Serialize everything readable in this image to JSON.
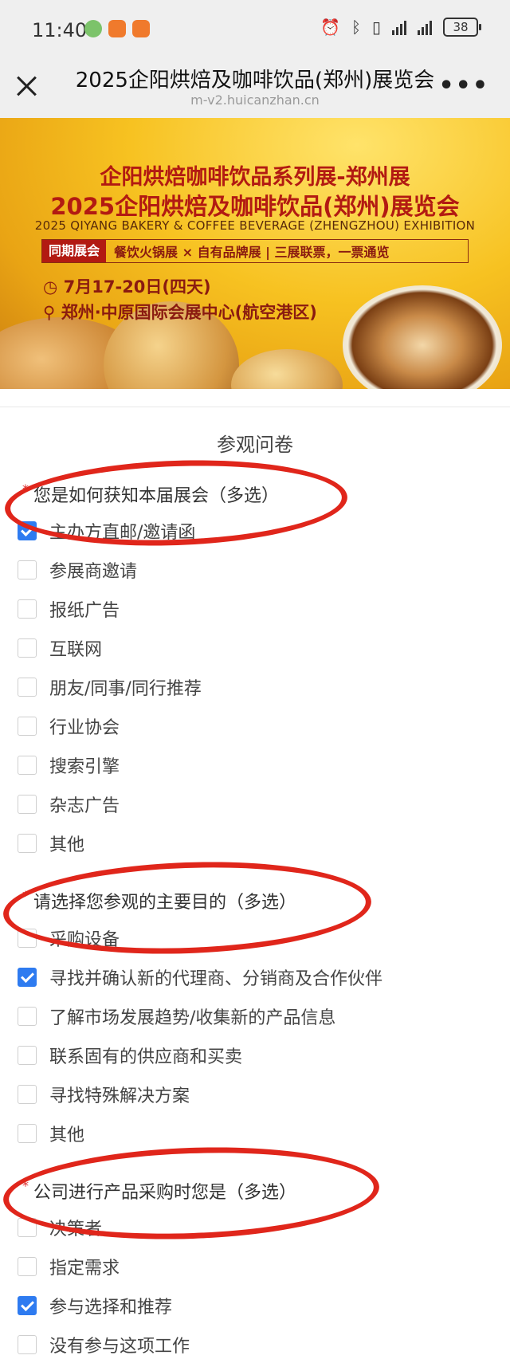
{
  "status_bar": {
    "time": "11:40",
    "battery": "38",
    "icons": [
      "china-mobile-icon",
      "app-icon",
      "app-icon",
      "alarm-icon",
      "bluetooth-icon",
      "vibrate-icon",
      "signal-icon",
      "signal-icon",
      "battery-icon"
    ]
  },
  "title_bar": {
    "title": "2025企阳烘焙及咖啡饮品(郑州)展览会",
    "url": "m-v2.huicanzhan.cn",
    "more": "•••"
  },
  "banner": {
    "line1": "企阳烘焙咖啡饮品系列展-郑州展",
    "line2": "2025企阳烘焙及咖啡饮品(郑州)展览会",
    "line3": "2025 QIYANG BAKERY & COFFEE BEVERAGE (ZHENGZHOU) EXHIBITION",
    "tag": "同期展会",
    "strip_text": "餐饮火锅展 × 自有品牌展  |  三展联票，一票通览",
    "date": "7月17-20日(四天)",
    "venue": "郑州·中原国际会展中心(航空港区)",
    "accent_red": "#b21a12",
    "accent_yellow": "#f7c221"
  },
  "form": {
    "title": "参观问卷",
    "checkbox_color": "#2e7bf0",
    "annotation_color": "#e0261b",
    "questions": [
      {
        "required": "*",
        "label": "您是如何获知本届展会（多选）",
        "options": [
          {
            "label": "主办方直邮/邀请函",
            "checked": true
          },
          {
            "label": "参展商邀请",
            "checked": false
          },
          {
            "label": "报纸广告",
            "checked": false
          },
          {
            "label": "互联网",
            "checked": false
          },
          {
            "label": "朋友/同事/同行推荐",
            "checked": false
          },
          {
            "label": "行业协会",
            "checked": false
          },
          {
            "label": "搜索引擎",
            "checked": false
          },
          {
            "label": "杂志广告",
            "checked": false
          },
          {
            "label": "其他",
            "checked": false
          }
        ]
      },
      {
        "required": "*",
        "label": "请选择您参观的主要目的（多选）",
        "options": [
          {
            "label": "采购设备",
            "checked": false
          },
          {
            "label": "寻找并确认新的代理商、分销商及合作伙伴",
            "checked": true
          },
          {
            "label": "了解市场发展趋势/收集新的产品信息",
            "checked": false
          },
          {
            "label": "联系固有的供应商和买卖",
            "checked": false
          },
          {
            "label": "寻找特殊解决方案",
            "checked": false
          },
          {
            "label": "其他",
            "checked": false
          }
        ]
      },
      {
        "required": "*",
        "label": "公司进行产品采购时您是（多选）",
        "options": [
          {
            "label": "决策者",
            "checked": false
          },
          {
            "label": "指定需求",
            "checked": false
          },
          {
            "label": "参与选择和推荐",
            "checked": true
          },
          {
            "label": "没有参与这项工作",
            "checked": false
          }
        ]
      }
    ]
  }
}
